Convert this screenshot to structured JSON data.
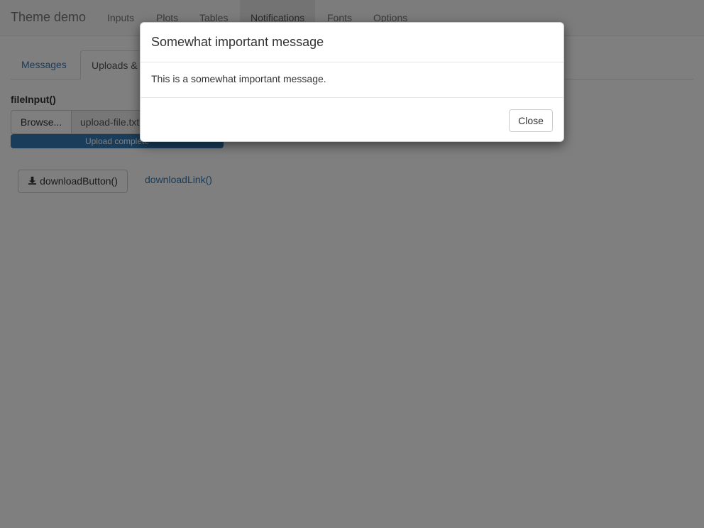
{
  "navbar": {
    "brand": "Theme demo",
    "items": [
      {
        "label": "Inputs"
      },
      {
        "label": "Plots"
      },
      {
        "label": "Tables"
      },
      {
        "label": "Notifications",
        "active": true
      },
      {
        "label": "Fonts"
      },
      {
        "label": "Options"
      }
    ]
  },
  "tabs": [
    {
      "label": "Messages"
    },
    {
      "label": "Uploads & Downloads",
      "active": true
    }
  ],
  "upload": {
    "label": "fileInput()",
    "browse_label": "Browse...",
    "file_name": "upload-file.txt",
    "progress_text": "Upload complete",
    "progress": 1.0
  },
  "downloads": {
    "button_label": "downloadButton()",
    "link_label": "downloadLink()"
  },
  "modal": {
    "title": "Somewhat important message",
    "body": "This is a somewhat important message.",
    "close_label": "Close"
  },
  "colors": {
    "primary": "#337ab7",
    "backdrop": "rgba(0,0,0,0.5)"
  }
}
